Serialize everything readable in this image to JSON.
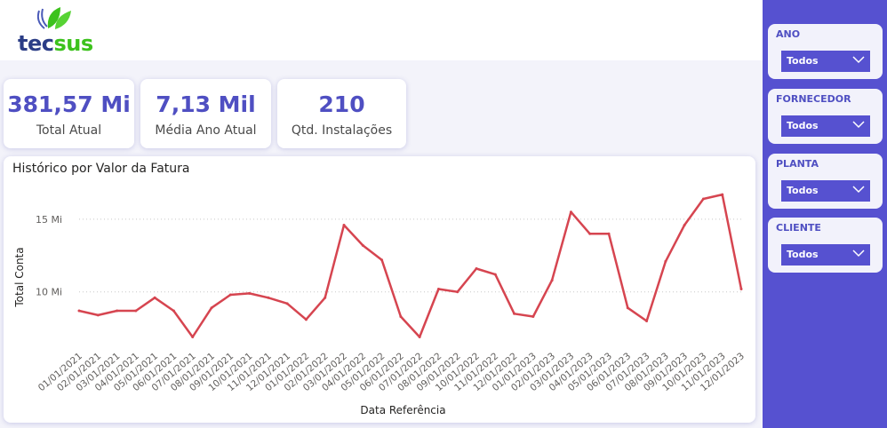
{
  "brand": {
    "logo_text_1": "tec",
    "logo_text_2": "sus",
    "colors": {
      "primary": "#5651d0",
      "accent_text": "#4f4fc2",
      "line": "#d64550",
      "logo_blue": "#2b3d86",
      "logo_green": "#3cc21c"
    }
  },
  "kpis": [
    {
      "value": "381,57 Mi",
      "label": "Total Atual"
    },
    {
      "value": "7,13 Mil",
      "label": "Média Ano Atual"
    },
    {
      "value": "210",
      "label": "Qtd. Instalações"
    }
  ],
  "filters": [
    {
      "label": "ANO",
      "value": "Todos",
      "icon": "chevron-down-icon"
    },
    {
      "label": "FORNECEDOR",
      "value": "Todos",
      "icon": "chevron-down-icon"
    },
    {
      "label": "PLANTA",
      "value": "Todos",
      "icon": "chevron-down-icon"
    },
    {
      "label": "CLIENTE",
      "value": "Todos",
      "icon": "chevron-down-icon"
    }
  ],
  "chart_data": {
    "type": "line",
    "title": "Histórico por Valor da Fatura",
    "xlabel": "Data Referência",
    "ylabel": "Total Conta",
    "ylim": [
      6.5,
      17.5
    ],
    "yticks": [
      10,
      15
    ],
    "ytick_labels": [
      "10 Mi",
      "15 Mi"
    ],
    "grid": true,
    "x": [
      "01/01/2021",
      "02/01/2021",
      "03/01/2021",
      "04/01/2021",
      "05/01/2021",
      "06/01/2021",
      "07/01/2021",
      "08/01/2021",
      "09/01/2021",
      "10/01/2021",
      "11/01/2021",
      "12/01/2021",
      "01/01/2022",
      "02/01/2022",
      "03/01/2022",
      "04/01/2022",
      "05/01/2022",
      "06/01/2022",
      "07/01/2022",
      "08/01/2022",
      "09/01/2022",
      "10/01/2022",
      "11/01/2022",
      "12/01/2022",
      "01/01/2023",
      "02/01/2023",
      "03/01/2023",
      "04/01/2023",
      "05/01/2023",
      "06/01/2023",
      "07/01/2023",
      "08/01/2023",
      "09/01/2023",
      "10/01/2023",
      "11/01/2023",
      "12/01/2023"
    ],
    "series": [
      {
        "values": [
          8.7,
          8.4,
          8.7,
          8.7,
          9.6,
          8.7,
          6.9,
          8.9,
          9.8,
          9.9,
          9.6,
          9.2,
          8.1,
          9.6,
          14.6,
          13.2,
          12.2,
          8.3,
          6.9,
          10.2,
          10.0,
          11.6,
          11.2,
          8.5,
          8.3,
          10.8,
          15.5,
          14.0,
          14.0,
          8.9,
          8.0,
          12.1,
          14.6,
          16.4,
          16.7,
          10.2
        ]
      }
    ]
  }
}
